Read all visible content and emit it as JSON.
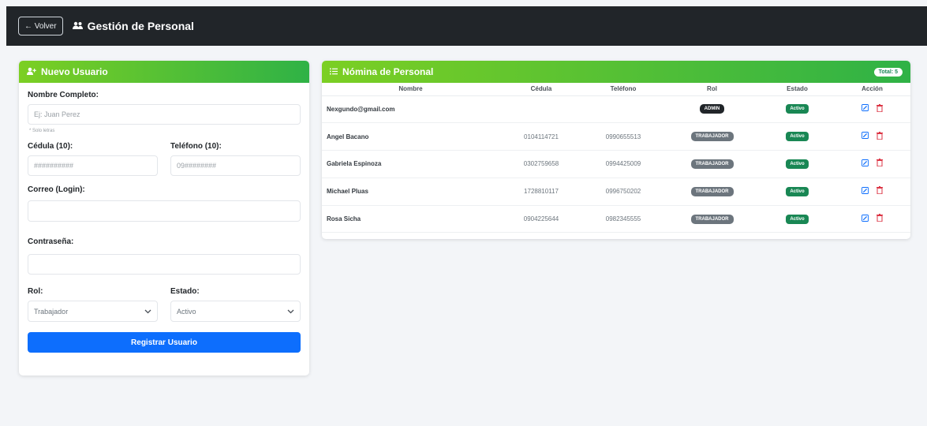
{
  "topbar": {
    "back_label": "← Volver",
    "title": "Gestión de Personal",
    "title_icon": "users-icon"
  },
  "form": {
    "header": "Nuevo Usuario",
    "header_icon": "user-plus-icon",
    "nombre_label": "Nombre Completo:",
    "nombre_placeholder": "Ej: Juan Perez",
    "nombre_hint": "* Solo letras",
    "cedula_label": "Cédula (10):",
    "cedula_placeholder": "##########",
    "telefono_label": "Teléfono (10):",
    "telefono_placeholder": "09########",
    "correo_label": "Correo (Login):",
    "correo_value": "",
    "contrasena_label": "Contraseña:",
    "contrasena_value": "",
    "rol_label": "Rol:",
    "rol_value": "Trabajador",
    "estado_label": "Estado:",
    "estado_value": "Activo",
    "submit_label": "Registrar Usuario"
  },
  "list": {
    "header": "Nómina de Personal",
    "header_icon": "list-icon",
    "total_badge": "Total: 5",
    "columns": [
      "Nombre",
      "Cédula",
      "Teléfono",
      "Rol",
      "Estado",
      "Acción"
    ],
    "rows": [
      {
        "nombre": "Nexgundo@gmail.com",
        "cedula": "",
        "telefono": "",
        "rol": "ADMIN",
        "estado": "Activo"
      },
      {
        "nombre": "Angel Bacano",
        "cedula": "0104114721",
        "telefono": "0990655513",
        "rol": "TRABAJADOR",
        "estado": "Activo"
      },
      {
        "nombre": "Gabriela Espinoza",
        "cedula": "0302759658",
        "telefono": "0994425009",
        "rol": "TRABAJADOR",
        "estado": "Activo"
      },
      {
        "nombre": "Michael Pluas",
        "cedula": "1728810117",
        "telefono": "0996750202",
        "rol": "TRABAJADOR",
        "estado": "Activo"
      },
      {
        "nombre": "Rosa Sicha",
        "cedula": "0904225644",
        "telefono": "0982345555",
        "rol": "TRABAJADOR",
        "estado": "Activo"
      }
    ]
  },
  "colors": {
    "topbar": "#212529",
    "header_gradient_start": "#7ccf23",
    "header_gradient_end": "#2fb246",
    "primary": "#0d6efd",
    "success": "#198754",
    "danger": "#dc3545"
  }
}
